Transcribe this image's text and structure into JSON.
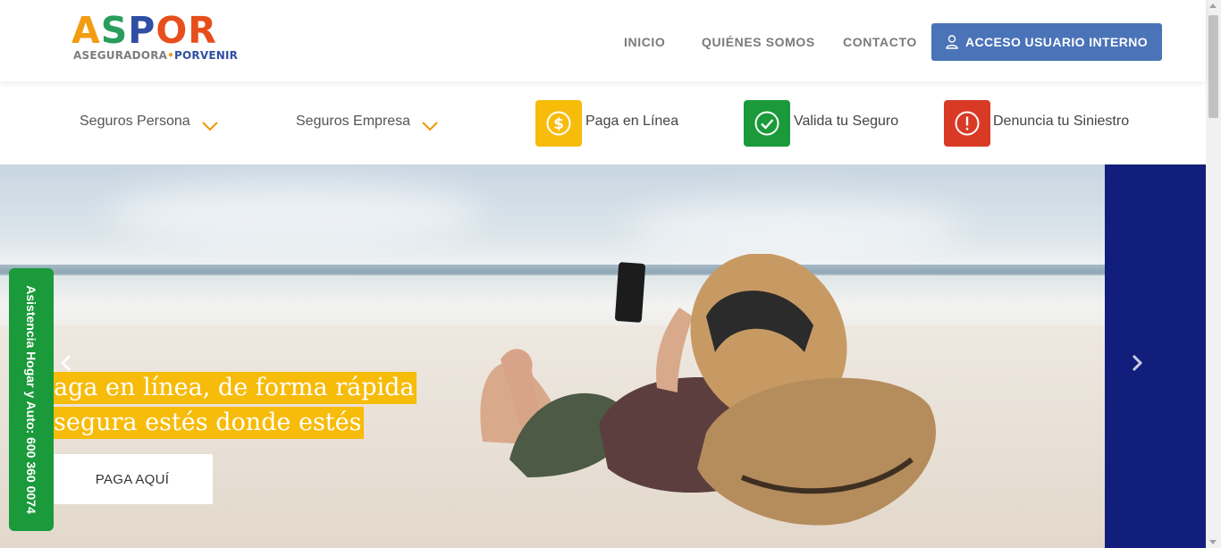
{
  "brand": {
    "logo_word": "ASPOR",
    "logo_sub_a": "ASEGURADORA",
    "logo_sub_dot": "•",
    "logo_sub_b": "PORVENIR",
    "colors": {
      "A": "#f39c12",
      "S": "#2a9d5c",
      "P": "#2e4fa3",
      "O": "#e84e1b",
      "R": "#e84e1b"
    }
  },
  "nav": {
    "inicio": "INICIO",
    "quienes": "QUIÉNES SOMOS",
    "contacto": "CONTACTO",
    "acceso_label": "ACCESO USUARIO INTERNO",
    "acceso_icon": "user-icon"
  },
  "subnav": {
    "persona": "Seguros Persona",
    "empresa": "Seguros Empresa",
    "paga": "Paga en Línea",
    "valida": "Valida tu Seguro",
    "denuncia": "Denuncia tu Siniestro",
    "paga_icon": "dollar-icon",
    "valida_icon": "check-icon",
    "denuncia_icon": "alert-icon",
    "accent_yellow": "#f7bb0a",
    "accent_green": "#1a9a3a",
    "accent_red": "#d93a26"
  },
  "hero": {
    "line1": "aga en línea, de forma rápida",
    "line2": "segura estés donde estés",
    "cta": "PAGA AQUÍ",
    "panel_color": "#111e7c"
  },
  "side_tab": {
    "label": "Asistencia Hogar y Auto: 600 360 0074"
  }
}
